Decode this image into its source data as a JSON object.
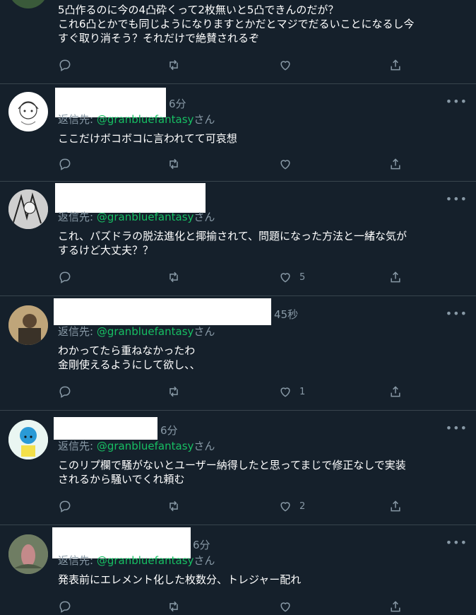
{
  "tweets": [
    {
      "top_text": [
        "5凸作るのに今の4凸砕くって2枚無いと5凸できんのだが？",
        "これ6凸とかでも同じようになりますとかだとマジでだるいことになるし今",
        "すぐ取り消そう？それだけで絶賛されるぞ"
      ],
      "likes": ""
    },
    {
      "time": "6分",
      "reply_prefix": "返信先: ",
      "reply_handle": "@granbluefantasy",
      "reply_suffix": "さん",
      "text": [
        "ここだけボコボコに言われてて可哀想"
      ],
      "likes": ""
    },
    {
      "time": "",
      "reply_prefix": "返信先: ",
      "reply_handle": "@granbluefantasy",
      "reply_suffix": "さん",
      "text": [
        "これ、パズドラの脱法進化と揶揄されて、問題になった方法と一緒な気が",
        "するけど大丈夫？？"
      ],
      "likes": "5"
    },
    {
      "time": "45秒",
      "reply_prefix": "返信先: ",
      "reply_handle": "@granbluefantasy",
      "reply_suffix": "さん",
      "text": [
        "わかってたら重ねなかったわ",
        "金剛使えるようにして欲し、、"
      ],
      "likes": "1"
    },
    {
      "time": "6分",
      "reply_prefix": "返信先: ",
      "reply_handle": "@granbluefantasy",
      "reply_suffix": "さん",
      "text": [
        "このリプ欄で騒がないとユーザー納得したと思ってまじで修正なしで実装",
        "されるから騒いでくれ頼む"
      ],
      "likes": "2"
    },
    {
      "time": "6分",
      "reply_prefix": "返信先: ",
      "reply_handle": "@granbluefantasy",
      "reply_suffix": "さん",
      "text": [
        "発表前にエレメント化した枚数分、トレジャー配れ"
      ],
      "likes": ""
    }
  ],
  "more_label": "•••",
  "icons": {
    "reply": "reply-icon",
    "retweet": "retweet-icon",
    "like": "heart-icon",
    "share": "share-icon",
    "more": "more-icon"
  },
  "colors": {
    "background": "#15202b",
    "divider": "#38444d",
    "muted": "#8899a6",
    "handle": "#17bf63"
  }
}
